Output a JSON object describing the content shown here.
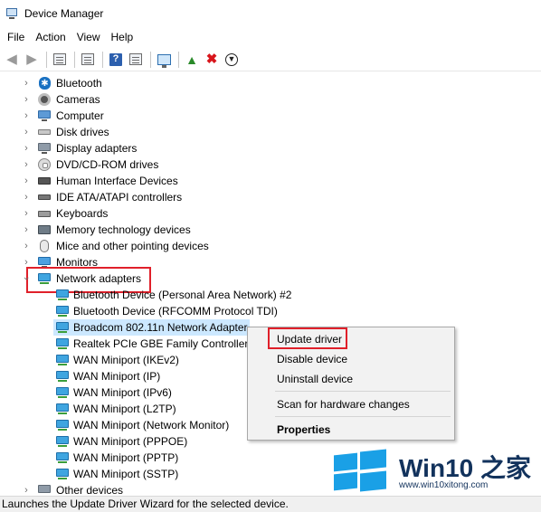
{
  "window": {
    "title": "Device Manager",
    "app_icon": "device-manager-icon"
  },
  "menu": [
    "File",
    "Action",
    "View",
    "Help"
  ],
  "toolbar": {
    "buttons": [
      "back-arrow-icon",
      "forward-arrow-icon",
      "show-hide-tree-icon",
      "properties-icon",
      "help-icon",
      "action-pane-icon",
      "scan-hardware-icon",
      "update-driver-icon",
      "uninstall-icon",
      "enable-disable-icon"
    ]
  },
  "tree": {
    "categories": [
      {
        "label": "Bluetooth",
        "icon": "bluetooth-icon"
      },
      {
        "label": "Cameras",
        "icon": "camera-icon"
      },
      {
        "label": "Computer",
        "icon": "computer-icon"
      },
      {
        "label": "Disk drives",
        "icon": "disk-drive-icon"
      },
      {
        "label": "Display adapters",
        "icon": "display-adapter-icon"
      },
      {
        "label": "DVD/CD-ROM drives",
        "icon": "dvd-drive-icon"
      },
      {
        "label": "Human Interface Devices",
        "icon": "hid-icon"
      },
      {
        "label": "IDE ATA/ATAPI controllers",
        "icon": "ide-controller-icon"
      },
      {
        "label": "Keyboards",
        "icon": "keyboard-icon"
      },
      {
        "label": "Memory technology devices",
        "icon": "memory-icon"
      },
      {
        "label": "Mice and other pointing devices",
        "icon": "mouse-icon"
      },
      {
        "label": "Monitors",
        "icon": "monitor-icon"
      }
    ],
    "network_adapters": {
      "label": "Network adapters",
      "expanded": true,
      "children": [
        "Bluetooth Device (Personal Area Network) #2",
        "Bluetooth Device (RFCOMM Protocol TDI)",
        "Broadcom 802.11n Network Adapter",
        "Realtek PCIe GBE Family Controller",
        "WAN Miniport (IKEv2)",
        "WAN Miniport (IP)",
        "WAN Miniport (IPv6)",
        "WAN Miniport (L2TP)",
        "WAN Miniport (Network Monitor)",
        "WAN Miniport (PPPOE)",
        "WAN Miniport (PPTP)",
        "WAN Miniport (SSTP)"
      ],
      "selected_child": "Broadcom 802.11n Network Adapter"
    },
    "other_devices": {
      "label": "Other devices"
    }
  },
  "context_menu": {
    "update_driver": "Update driver",
    "disable_device": "Disable device",
    "uninstall_device": "Uninstall device",
    "scan_hardware": "Scan for hardware changes",
    "properties": "Properties"
  },
  "status": "Launches the Update Driver Wizard for the selected device.",
  "watermark": {
    "title_a": "Win10",
    "title_b": " 之家",
    "url": "www.win10xitong.com"
  },
  "colors": {
    "highlight_border": "#e0202a",
    "selection": "#cce8ff",
    "watermark_blue": "#1aa0e6",
    "watermark_text": "#12325c"
  }
}
